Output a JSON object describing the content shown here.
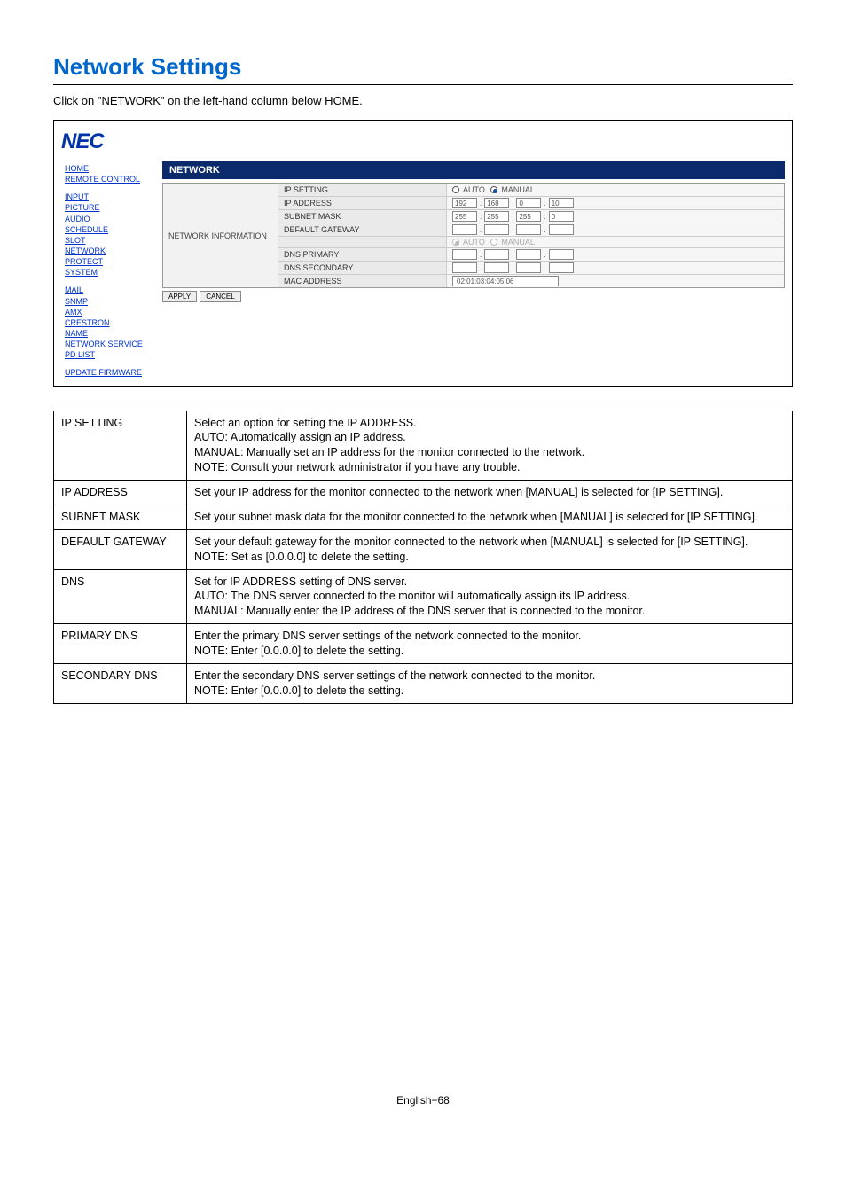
{
  "page": {
    "title": "Network Settings",
    "subtitle": "Click on \"NETWORK\" on the left-hand column below HOME.",
    "footer": "English−68"
  },
  "brand": "NEC",
  "sidebar": {
    "group1": [
      "HOME",
      "REMOTE CONTROL"
    ],
    "group2": [
      "INPUT",
      "PICTURE",
      "AUDIO",
      "SCHEDULE",
      "SLOT",
      "NETWORK",
      "PROTECT",
      "SYSTEM"
    ],
    "group3": [
      "MAIL",
      "SNMP",
      "AMX",
      "CRESTRON",
      "NAME",
      "NETWORK SERVICE",
      "PD LIST"
    ],
    "group4": [
      "UPDATE FIRMWARE"
    ]
  },
  "section_bar": "NETWORK",
  "net": {
    "info_label": "NETWORK INFORMATION",
    "rows": {
      "ip_setting": {
        "label": "IP SETTING",
        "auto": "AUTO",
        "manual": "MANUAL"
      },
      "ip_address": {
        "label": "IP ADDRESS",
        "oct": [
          "192",
          "168",
          "0",
          "10"
        ]
      },
      "subnet_mask": {
        "label": "SUBNET MASK",
        "oct": [
          "255",
          "255",
          "255",
          "0"
        ]
      },
      "default_gw": {
        "label": "DEFAULT GATEWAY",
        "oct": [
          "",
          "",
          "",
          ""
        ]
      },
      "dns_mode": {
        "label": "",
        "auto": "AUTO",
        "manual": "MANUAL"
      },
      "dns_primary": {
        "label": "DNS PRIMARY",
        "oct": [
          "",
          "",
          "",
          ""
        ]
      },
      "dns_secondary": {
        "label": "DNS SECONDARY",
        "oct": [
          "",
          "",
          "",
          ""
        ]
      },
      "mac": {
        "label": "MAC ADDRESS",
        "value": "02:01:03:04:05:06"
      }
    },
    "buttons": {
      "apply": "APPLY",
      "cancel": "CANCEL"
    }
  },
  "desc": [
    {
      "key": "IP SETTING",
      "val": "Select an option for setting the IP ADDRESS.\nAUTO: Automatically assign an IP address.\nMANUAL: Manually set an IP address for the monitor connected to the network.\nNOTE: Consult your network administrator if you have any trouble."
    },
    {
      "key": "IP ADDRESS",
      "val": "Set your IP address for the monitor connected to the network when [MANUAL] is selected for [IP SETTING]."
    },
    {
      "key": "SUBNET MASK",
      "val": "Set your subnet mask data for the monitor connected to the network when [MANUAL] is selected for [IP SETTING]."
    },
    {
      "key": "DEFAULT GATEWAY",
      "val": "Set your default gateway for the monitor connected to the network when [MANUAL] is selected for [IP SETTING].\nNOTE: Set as [0.0.0.0] to delete the setting."
    },
    {
      "key": "DNS",
      "val": "Set for IP ADDRESS setting of DNS server.\nAUTO: The DNS server connected to the monitor will automatically assign its IP address.\nMANUAL: Manually enter the IP address of the DNS server that is connected to the monitor."
    },
    {
      "key": "PRIMARY DNS",
      "val": "Enter the primary DNS server settings of the network connected to the monitor.\nNOTE: Enter [0.0.0.0] to delete the setting."
    },
    {
      "key": "SECONDARY DNS",
      "val": "Enter the secondary DNS server settings of the network connected to the monitor.\nNOTE: Enter [0.0.0.0] to delete the setting."
    }
  ]
}
